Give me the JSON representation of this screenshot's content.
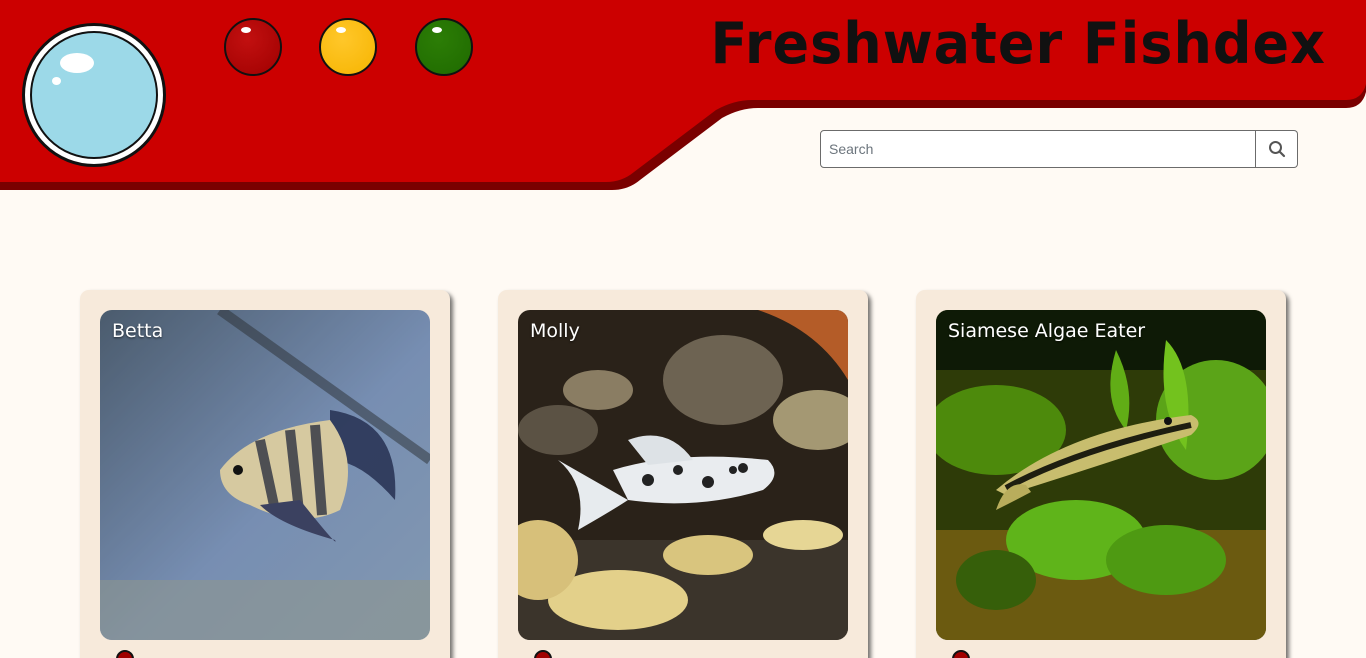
{
  "header": {
    "title": "Freshwater Fishdex",
    "colors": {
      "banner": "#cc0000",
      "banner_edge": "#7a0000",
      "lens": "#9cd9e8",
      "light_red": "#b30000",
      "light_yellow": "#ffbf00",
      "light_green": "#267300"
    },
    "icons": [
      "lens-icon",
      "red-light-icon",
      "yellow-light-icon",
      "green-light-icon"
    ]
  },
  "search": {
    "placeholder": "Search",
    "value": "",
    "button_icon": "search-icon"
  },
  "page_background": "#fffaf4",
  "cards": [
    {
      "name": "Betta"
    },
    {
      "name": "Molly"
    },
    {
      "name": "Siamese Algae Eater"
    }
  ]
}
